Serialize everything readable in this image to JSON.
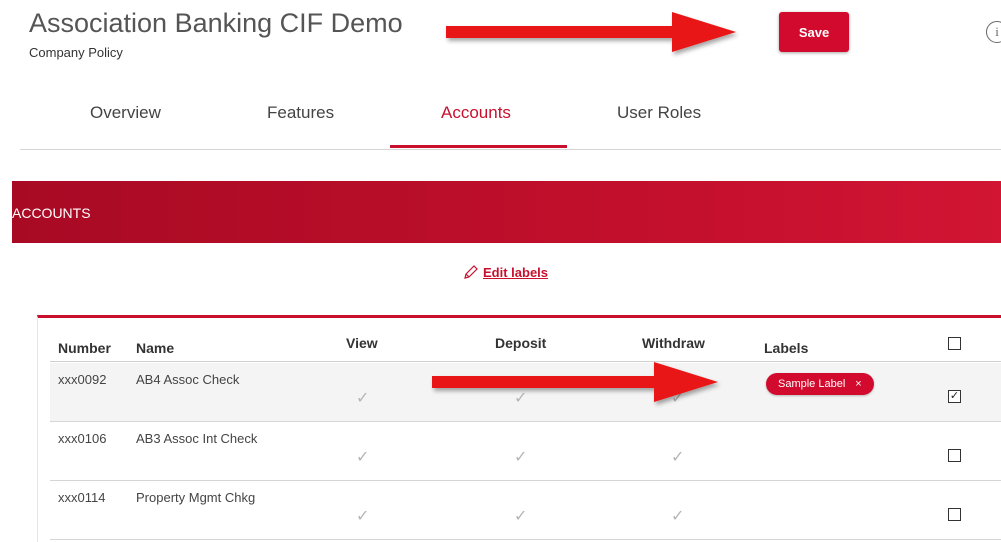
{
  "page": {
    "title": "Association Banking CIF Demo",
    "subtitle": "Company Policy",
    "save_label": "Save",
    "info_glyph": "i"
  },
  "tabs": [
    {
      "label": "Overview",
      "active": false
    },
    {
      "label": "Features",
      "active": false
    },
    {
      "label": "Accounts",
      "active": true
    },
    {
      "label": "User Roles",
      "active": false
    }
  ],
  "banner": {
    "label": "ACCOUNTS"
  },
  "edit_labels": {
    "label": "Edit labels",
    "icon": "pencil-icon"
  },
  "table": {
    "columns": [
      "Number",
      "Name",
      "View",
      "Deposit",
      "Withdraw",
      "Labels"
    ],
    "select_all_checked": false,
    "rows": [
      {
        "number": "xxx0092",
        "name": "AB4 Assoc Check",
        "view": true,
        "deposit": true,
        "withdraw": true,
        "label": "Sample Label",
        "label_remove": "×",
        "selected": true
      },
      {
        "number": "xxx0106",
        "name": "AB3 Assoc Int Check",
        "view": true,
        "deposit": true,
        "withdraw": true,
        "label": "",
        "selected": false
      },
      {
        "number": "xxx0114",
        "name": "Property Mgmt Chkg",
        "view": true,
        "deposit": true,
        "withdraw": true,
        "label": "",
        "selected": false
      }
    ]
  },
  "colors": {
    "accent": "#c8102e",
    "arrow": "#e81414"
  },
  "check_glyph": "✓",
  "checked_glyph": "✓"
}
